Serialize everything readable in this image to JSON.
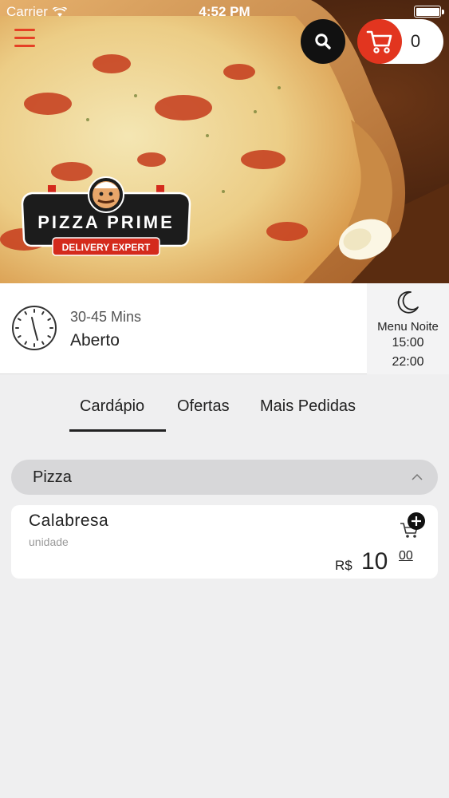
{
  "status_bar": {
    "carrier": "Carrier",
    "time": "4:52 PM"
  },
  "header": {
    "cart_count": "0",
    "logo": {
      "title": "PIZZA PRIME",
      "subtitle": "DELIVERY EXPERT"
    }
  },
  "info": {
    "delivery_time": "30-45 Mins",
    "status": "Aberto",
    "menu_label": "Menu Noite",
    "open_time": "15:00",
    "close_time": "22:00"
  },
  "tabs": [
    {
      "label": "Cardápio",
      "active": true
    },
    {
      "label": "Ofertas",
      "active": false
    },
    {
      "label": "Mais Pedidas",
      "active": false
    }
  ],
  "category": {
    "name": "Pizza"
  },
  "products": [
    {
      "name": "Calabresa",
      "unit": "unidade",
      "currency": "R$",
      "price_int": "10",
      "price_dec": "00"
    }
  ],
  "colors": {
    "accent_red": "#e2351f",
    "search_black": "#111111",
    "page_bg": "#efeff0",
    "category_bg": "#d7d7d9"
  },
  "icons": {
    "search": "search-icon",
    "cart": "cart-icon",
    "clock": "clock-icon",
    "moon": "moon-icon",
    "chevron": "chevron-up-icon",
    "add_to_cart": "add-to-cart-icon"
  }
}
